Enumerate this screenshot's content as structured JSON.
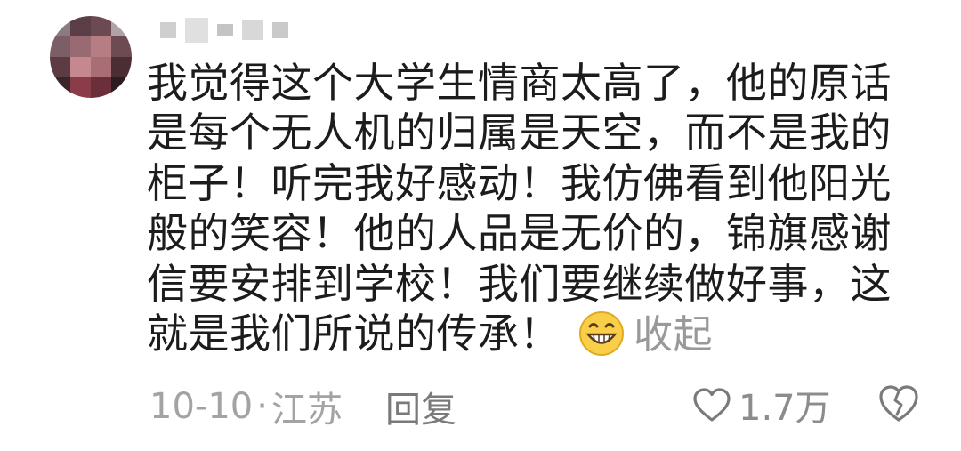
{
  "avatar": {
    "colors": [
      "#8b7b80",
      "#5a3f47",
      "#6b4a52",
      "#b0a2a6",
      "#7c5f66",
      "#9a6a72",
      "#b67d82",
      "#6e4b52",
      "#5c3c42",
      "#c4888e",
      "#a96d75",
      "#4a2e33",
      "#3b2529",
      "#8a3c4a",
      "#6a2f38",
      "#2e1b1f"
    ]
  },
  "comment": {
    "text": "我觉得这个大学生情商太高了，他的原话是每个无人机的归属是天空，而不是我的柜子！听完我好感动！我仿佛看到他阳光般的笑容！他的人品是无价的，锦旗感谢信要安排到学校！我们要继续做好事，这就是我们所说的传承！",
    "emoji_icon": "grinning-face-icon",
    "collapse_label": "收起"
  },
  "meta": {
    "date": "10-10",
    "dot": "·",
    "location": "江苏",
    "reply_label": "回复"
  },
  "actions": {
    "like_icon": "heart-outline-icon",
    "like_count": "1.7万",
    "dislike_icon": "broken-heart-icon"
  },
  "colors": {
    "text": "#1c1c1c",
    "muted": "#a3a3a3",
    "collapse": "#999999",
    "emoji_face": "#f9cf4a"
  }
}
